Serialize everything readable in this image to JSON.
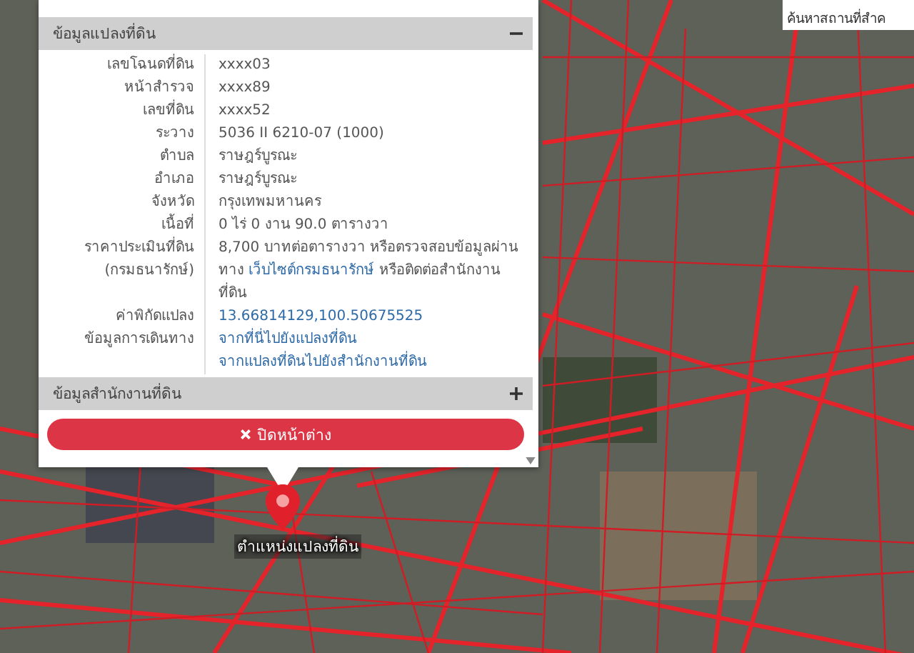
{
  "search": {
    "placeholder": "ค้นหาสถานที่สำค"
  },
  "popup": {
    "sections": [
      {
        "title": "ข้อมูลแปลงที่ดิน",
        "expanded": true,
        "rows": [
          {
            "label": [
              "เลขโฉนดที่ดิน"
            ],
            "lines": [
              [
                {
                  "kind": "text",
                  "text": "xxxx03"
                }
              ]
            ]
          },
          {
            "label": [
              "หน้าสำรวจ"
            ],
            "lines": [
              [
                {
                  "kind": "text",
                  "text": "xxxx89"
                }
              ]
            ]
          },
          {
            "label": [
              "เลขที่ดิน"
            ],
            "lines": [
              [
                {
                  "kind": "text",
                  "text": "xxxx52"
                }
              ]
            ]
          },
          {
            "label": [
              "ระวาง"
            ],
            "lines": [
              [
                {
                  "kind": "text",
                  "text": "5036 II 6210-07 (1000)"
                }
              ]
            ]
          },
          {
            "label": [
              "ตำบล"
            ],
            "lines": [
              [
                {
                  "kind": "text",
                  "text": "ราษฎร์บูรณะ"
                }
              ]
            ]
          },
          {
            "label": [
              "อำเภอ"
            ],
            "lines": [
              [
                {
                  "kind": "text",
                  "text": "ราษฎร์บูรณะ"
                }
              ]
            ]
          },
          {
            "label": [
              "จังหวัด"
            ],
            "lines": [
              [
                {
                  "kind": "text",
                  "text": "กรุงเทพมหานคร"
                }
              ]
            ]
          },
          {
            "label": [
              "เนื้อที่"
            ],
            "lines": [
              [
                {
                  "kind": "text",
                  "text": "0 ไร่ 0 งาน 90.0 ตารางวา"
                }
              ]
            ]
          },
          {
            "label": [
              "ราคาประเมินที่ดิน",
              "(กรมธนารักษ์)"
            ],
            "lines": [
              [
                {
                  "kind": "text",
                  "text": "8,700 บาทต่อตารางวา หรือตรวจสอบข้อมูลผ่านทาง "
                },
                {
                  "kind": "link",
                  "text": "เว็บไซต์กรมธนารักษ์"
                },
                {
                  "kind": "text",
                  "text": " หรือติดต่อสำนักงานที่ดิน"
                }
              ]
            ]
          },
          {
            "label": [
              "ค่าพิกัดแปลง"
            ],
            "lines": [
              [
                {
                  "kind": "link",
                  "text": "13.66814129,100.50675525"
                }
              ]
            ]
          },
          {
            "label": [
              "ข้อมูลการเดินทาง"
            ],
            "lines": [
              [
                {
                  "kind": "link",
                  "text": "จากที่นี่ไปยังแปลงที่ดิน"
                }
              ],
              [
                {
                  "kind": "link",
                  "text": "จากแปลงที่ดินไปยังสำนักงานที่ดิน"
                }
              ]
            ]
          }
        ]
      },
      {
        "title": "ข้อมูลสำนักงานที่ดิน",
        "expanded": false
      }
    ],
    "close_button": "ปิดหน้าต่าง"
  },
  "pin": {
    "label": "ตำแหน่งแปลงที่ดิน"
  }
}
